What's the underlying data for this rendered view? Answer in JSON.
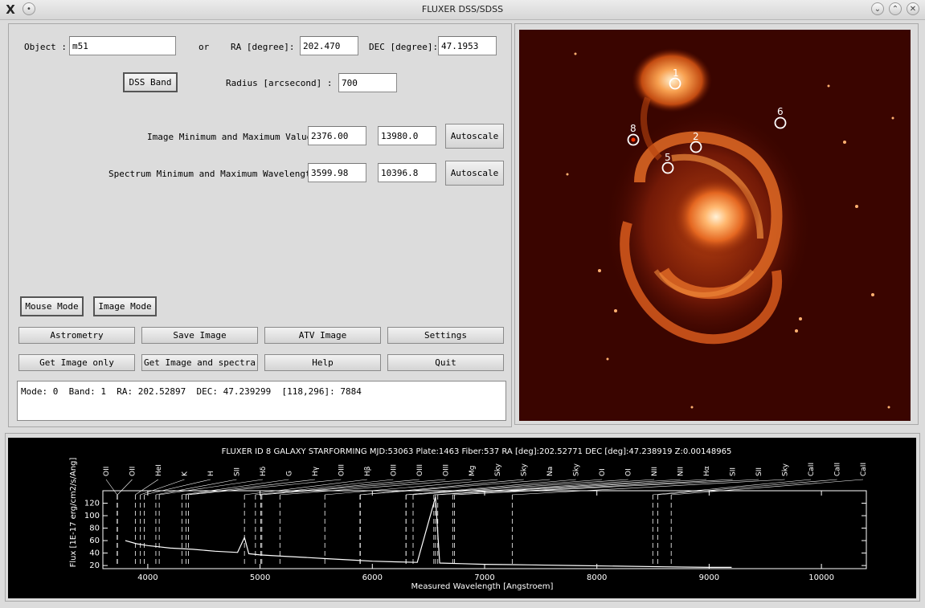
{
  "window": {
    "title": "FLUXER DSS/SDSS",
    "app_icon": "X"
  },
  "form": {
    "object_label": "Object :",
    "object_value": "m51",
    "or_label": "or",
    "ra_label": "RA  [degree]:",
    "ra_value": "202.470",
    "dec_label": "DEC [degree]:",
    "dec_value": "47.1953",
    "dss_band_label": "DSS Band",
    "radius_label": "Radius [arcsecond]   :",
    "radius_value": "700",
    "image_range_label": "Image Minimum and Maximum Value:",
    "image_min": "2376.00",
    "image_max": "13980.0",
    "spectrum_range_label": "Spectrum Minimum and Maximum Wavelength:",
    "spectrum_min": "3599.98",
    "spectrum_max": "10396.8",
    "autoscale_label": "Autoscale"
  },
  "modes": {
    "mouse_mode": "Mouse Mode",
    "image_mode": "Image Mode"
  },
  "buttons": {
    "astrometry": "Astrometry",
    "save_image": "Save Image",
    "atv_image": "ATV Image",
    "settings": "Settings",
    "get_image_only": "Get Image only",
    "get_image_spectra": "Get Image and spectra",
    "help": "Help",
    "quit": "Quit"
  },
  "status_text": "Mode: 0  Band: 1  RA: 202.52897  DEC: 47.239299  [118,296]: 7884",
  "image": {
    "markers": [
      {
        "label": "1"
      },
      {
        "label": "6"
      },
      {
        "label": "8"
      },
      {
        "label": "2"
      },
      {
        "label": "5"
      }
    ]
  },
  "chart_data": {
    "type": "line",
    "title": "FLUXER ID 8   GALAXY STARFORMING MJD:53063  Plate:1463  Fiber:537  RA [deg]:202.52771  DEC [deg]:47.238919  Z:0.00148965",
    "xlabel": "Measured Wavelength [Angstroem]",
    "ylabel": "Flux [1E-17 erg/cm2/s/Ang]",
    "xlim": [
      3600,
      10400
    ],
    "ylim": [
      15,
      140
    ],
    "x_ticks": [
      4000,
      5000,
      6000,
      7000,
      8000,
      9000,
      10000
    ],
    "y_ticks": [
      20,
      40,
      60,
      80,
      100,
      120
    ],
    "series": [
      {
        "x": [
          3800,
          3900,
          4000,
          4100,
          4200,
          4400,
          4600,
          4800,
          4861,
          4900,
          5000,
          5200,
          5400,
          5600,
          5800,
          6000,
          6200,
          6400,
          6563,
          6600,
          6800,
          7000,
          7400,
          7800,
          8200,
          8600,
          9000,
          9200
        ],
        "y": [
          60,
          55,
          52,
          50,
          48,
          46,
          43,
          41,
          65,
          39,
          37,
          35,
          33,
          31,
          29,
          27,
          26,
          25,
          130,
          24,
          23,
          22,
          21,
          20,
          19,
          18,
          17,
          17
        ]
      }
    ],
    "lines": [
      {
        "label": "OII",
        "x": 3727
      },
      {
        "label": "OII",
        "x": 3730
      },
      {
        "label": "HeI",
        "x": 3889
      },
      {
        "label": "K",
        "x": 3934
      },
      {
        "label": "H",
        "x": 3969
      },
      {
        "label": "SII",
        "x": 4072
      },
      {
        "label": "Hδ",
        "x": 4102
      },
      {
        "label": "G",
        "x": 4304
      },
      {
        "label": "Hγ",
        "x": 4340
      },
      {
        "label": "OIII",
        "x": 4363
      },
      {
        "label": "Hβ",
        "x": 4861
      },
      {
        "label": "OIII",
        "x": 4959
      },
      {
        "label": "OIII",
        "x": 5007
      },
      {
        "label": "OIII",
        "x": 5016
      },
      {
        "label": "Mg",
        "x": 5177
      },
      {
        "label": "Sky",
        "x": 5577
      },
      {
        "label": "Sky",
        "x": 5890
      },
      {
        "label": "Na",
        "x": 5893
      },
      {
        "label": "Sky",
        "x": 6300
      },
      {
        "label": "OI",
        "x": 6300
      },
      {
        "label": "OI",
        "x": 6363
      },
      {
        "label": "NII",
        "x": 6548
      },
      {
        "label": "NII",
        "x": 6583
      },
      {
        "label": "Hα",
        "x": 6563
      },
      {
        "label": "SII",
        "x": 6716
      },
      {
        "label": "SII",
        "x": 6731
      },
      {
        "label": "Sky",
        "x": 7246
      },
      {
        "label": "CaII",
        "x": 8498
      },
      {
        "label": "CaII",
        "x": 8542
      },
      {
        "label": "CaII",
        "x": 8662
      }
    ]
  }
}
